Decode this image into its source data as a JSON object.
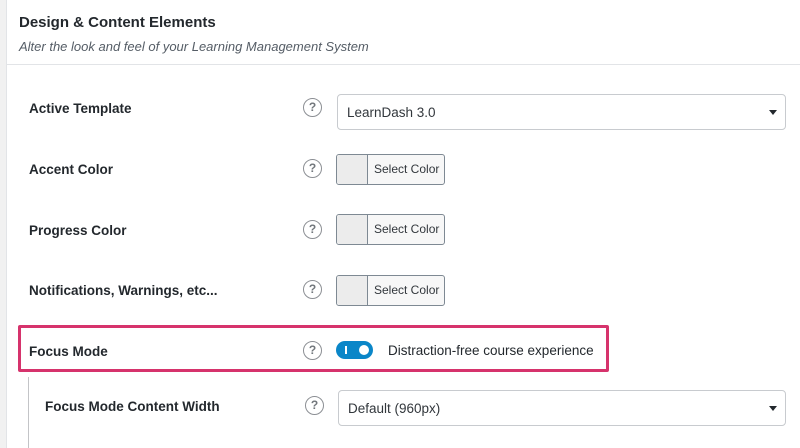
{
  "panel": {
    "title": "Design & Content Elements",
    "subtitle": "Alter the look and feel of your Learning Management System"
  },
  "rows": {
    "active_template": {
      "label": "Active Template",
      "help_glyph": "?",
      "selected": "LearnDash 3.0"
    },
    "accent_color": {
      "label": "Accent Color",
      "help_glyph": "?",
      "button": "Select Color"
    },
    "progress_color": {
      "label": "Progress Color",
      "help_glyph": "?",
      "button": "Select Color"
    },
    "notifications_color": {
      "label": "Notifications, Warnings, etc...",
      "help_glyph": "?",
      "button": "Select Color"
    },
    "focus_mode": {
      "label": "Focus Mode",
      "help_glyph": "?",
      "enabled": true,
      "description": "Distraction-free course experience"
    },
    "focus_width": {
      "label": "Focus Mode Content Width",
      "help_glyph": "?",
      "selected": "Default (960px)"
    }
  },
  "icons": {
    "help": "question-circle-icon",
    "dropdown": "caret-down-icon"
  },
  "colors": {
    "toggle_on": "#0a86c8",
    "highlight": "#d6336c"
  }
}
